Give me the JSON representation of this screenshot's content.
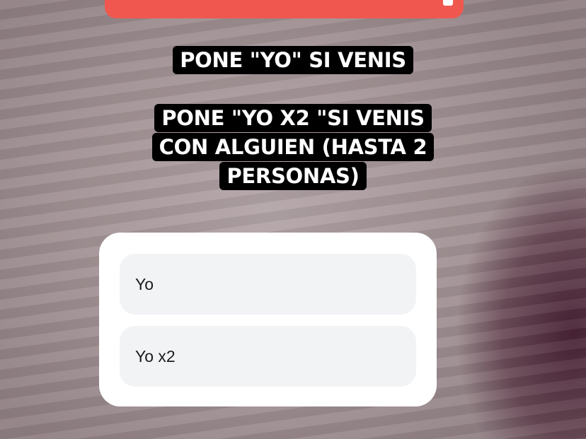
{
  "captions": {
    "line1": "PONE \"YO\" SI VENIS",
    "line2": "PONE \"YO X2 \"SI VENIS CON ALGUIEN (HASTA 2 PERSONAS)"
  },
  "poll": {
    "options": [
      {
        "label": "Yo"
      },
      {
        "label": "Yo x2"
      }
    ]
  },
  "colors": {
    "banner": "#f0584f",
    "caption_bg": "#000000",
    "card_bg": "#ffffff",
    "option_bg": "#f2f3f5"
  }
}
